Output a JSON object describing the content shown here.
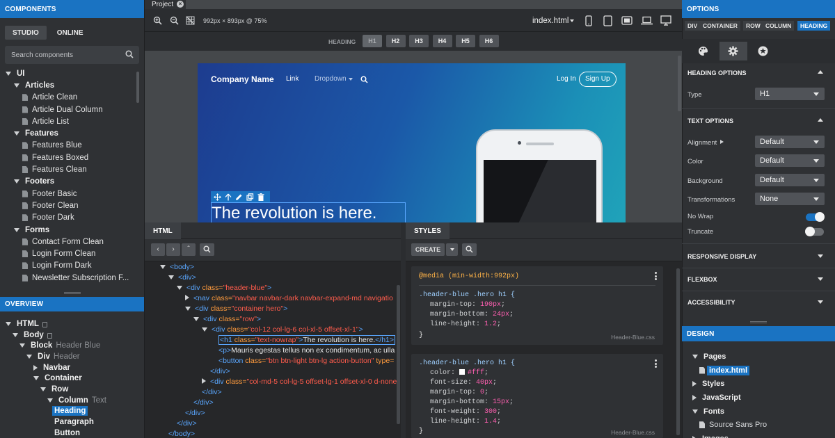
{
  "components": {
    "header": "COMPONENTS",
    "tabs": [
      "STUDIO",
      "ONLINE"
    ],
    "search_placeholder": "Search components",
    "tree": [
      {
        "label": "UI",
        "level": 0,
        "kind": "group"
      },
      {
        "label": "Articles",
        "level": 1,
        "kind": "group"
      },
      {
        "label": "Article Clean",
        "level": 2,
        "kind": "item"
      },
      {
        "label": "Article Dual Column",
        "level": 2,
        "kind": "item"
      },
      {
        "label": "Article List",
        "level": 2,
        "kind": "item"
      },
      {
        "label": "Features",
        "level": 1,
        "kind": "group"
      },
      {
        "label": "Features Blue",
        "level": 2,
        "kind": "item"
      },
      {
        "label": "Features Boxed",
        "level": 2,
        "kind": "item"
      },
      {
        "label": "Features Clean",
        "level": 2,
        "kind": "item"
      },
      {
        "label": "Footers",
        "level": 1,
        "kind": "group"
      },
      {
        "label": "Footer Basic",
        "level": 2,
        "kind": "item"
      },
      {
        "label": "Footer Clean",
        "level": 2,
        "kind": "item"
      },
      {
        "label": "Footer Dark",
        "level": 2,
        "kind": "item"
      },
      {
        "label": "Forms",
        "level": 1,
        "kind": "group"
      },
      {
        "label": "Contact Form Clean",
        "level": 2,
        "kind": "item"
      },
      {
        "label": "Login Form Clean",
        "level": 2,
        "kind": "item"
      },
      {
        "label": "Login Form Dark",
        "level": 2,
        "kind": "item"
      },
      {
        "label": "Newsletter Subscription F...",
        "level": 2,
        "kind": "item"
      }
    ]
  },
  "overview": {
    "header": "OVERVIEW",
    "tree": [
      {
        "label": "HTML",
        "sub": "",
        "level": 0,
        "lock": true,
        "selected": false
      },
      {
        "label": "Body",
        "sub": "",
        "level": 1,
        "lock": true,
        "selected": false
      },
      {
        "label": "Block",
        "sub": "Header Blue",
        "level": 2,
        "lock": false,
        "selected": false
      },
      {
        "label": "Div",
        "sub": "Header",
        "level": 3,
        "lock": false,
        "selected": false
      },
      {
        "label": "Navbar",
        "sub": "",
        "level": 4,
        "lock": false,
        "selected": false,
        "collapsed": true
      },
      {
        "label": "Container",
        "sub": "",
        "level": 4,
        "lock": false,
        "selected": false
      },
      {
        "label": "Row",
        "sub": "",
        "level": 5,
        "lock": false,
        "selected": false
      },
      {
        "label": "Column",
        "sub": "Text",
        "level": 6,
        "lock": false,
        "selected": false
      },
      {
        "label": "Heading",
        "sub": "",
        "level": 7,
        "lock": false,
        "selected": true
      },
      {
        "label": "Paragraph",
        "sub": "",
        "level": 7,
        "lock": false,
        "selected": false
      },
      {
        "label": "Button",
        "sub": "",
        "level": 7,
        "lock": false,
        "selected": false
      }
    ]
  },
  "project": {
    "tab": "Project",
    "dimensions": "992px × 893px @ 75%",
    "file": "index.html",
    "heading_label": "HEADING",
    "heading_buttons": [
      "H1",
      "H2",
      "H3",
      "H4",
      "H5",
      "H6"
    ],
    "active_heading": "H1"
  },
  "preview": {
    "brand": "Company Name",
    "nav": [
      "Link",
      "Dropdown"
    ],
    "login": "Log In",
    "signup": "Sign Up",
    "headline": "The revolution is here."
  },
  "html_panel": {
    "tab": "HTML",
    "lines": [
      {
        "indent": 0,
        "open": true,
        "parts": [
          [
            "tg",
            "<body>"
          ]
        ]
      },
      {
        "indent": 1,
        "open": true,
        "parts": [
          [
            "tg",
            "<div>"
          ]
        ]
      },
      {
        "indent": 2,
        "open": true,
        "parts": [
          [
            "tg",
            "<div "
          ],
          [
            "at",
            "class="
          ],
          [
            "sv",
            "\"header-blue\""
          ],
          [
            "tg",
            ">"
          ]
        ]
      },
      {
        "indent": 3,
        "open": false,
        "parts": [
          [
            "tg",
            "<nav "
          ],
          [
            "at",
            "class="
          ],
          [
            "sv",
            "\"navbar navbar-dark navbar-expand-md navigatio"
          ]
        ]
      },
      {
        "indent": 3,
        "open": true,
        "parts": [
          [
            "tg",
            "<div "
          ],
          [
            "at",
            "class="
          ],
          [
            "sv",
            "\"container hero\""
          ],
          [
            "tg",
            ">"
          ]
        ]
      },
      {
        "indent": 4,
        "open": true,
        "parts": [
          [
            "tg",
            "<div "
          ],
          [
            "at",
            "class="
          ],
          [
            "sv",
            "\"row\""
          ],
          [
            "tg",
            ">"
          ]
        ]
      },
      {
        "indent": 5,
        "open": true,
        "parts": [
          [
            "tg",
            "<div "
          ],
          [
            "at",
            "class="
          ],
          [
            "sv",
            "\"col-12 col-lg-6 col-xl-5 offset-xl-1\""
          ],
          [
            "tg",
            ">"
          ]
        ]
      },
      {
        "indent": 6,
        "open": null,
        "selected": true,
        "parts": [
          [
            "tg",
            "<h1 "
          ],
          [
            "at",
            "class="
          ],
          [
            "sv",
            "\"text-nowrap\""
          ],
          [
            "tg",
            ">"
          ],
          [
            "tx",
            "The revolution is here."
          ],
          [
            "tg",
            "</h1>"
          ]
        ]
      },
      {
        "indent": 6,
        "open": null,
        "parts": [
          [
            "tg",
            "<p>"
          ],
          [
            "tx",
            "Mauris egestas tellus non ex condimentum, ac ulla"
          ]
        ]
      },
      {
        "indent": 6,
        "open": null,
        "parts": [
          [
            "tg",
            "<button "
          ],
          [
            "at",
            "class="
          ],
          [
            "sv",
            "\"btn btn-light btn-lg action-button\""
          ],
          [
            "at",
            " type="
          ]
        ]
      },
      {
        "indent": 5,
        "open": null,
        "parts": [
          [
            "tg",
            "</div>"
          ]
        ]
      },
      {
        "indent": 5,
        "open": false,
        "parts": [
          [
            "tg",
            "<div "
          ],
          [
            "at",
            "class="
          ],
          [
            "sv",
            "\"col-md-5 col-lg-5 offset-lg-1 offset-xl-0 d-none"
          ]
        ]
      },
      {
        "indent": 4,
        "open": null,
        "parts": [
          [
            "tg",
            "</div>"
          ]
        ]
      },
      {
        "indent": 3,
        "open": null,
        "parts": [
          [
            "tg",
            "</div>"
          ]
        ]
      },
      {
        "indent": 2,
        "open": null,
        "parts": [
          [
            "tg",
            "</div>"
          ]
        ]
      },
      {
        "indent": 1,
        "open": null,
        "parts": [
          [
            "tg",
            "</div>"
          ]
        ]
      },
      {
        "indent": 0,
        "open": null,
        "parts": [
          [
            "tg",
            "</body>"
          ]
        ]
      }
    ]
  },
  "styles_panel": {
    "tab": "STYLES",
    "create": "CREATE",
    "rule1": {
      "media": "@media (min-width:992px)",
      "selector": ".header-blue .hero h1 {",
      "props": [
        [
          "margin-top",
          "190px"
        ],
        [
          "margin-bottom",
          "24px"
        ],
        [
          "line-height",
          "1.2"
        ]
      ],
      "file": "Header-Blue.css"
    },
    "rule2": {
      "selector": ".header-blue .hero h1 {",
      "props": [
        [
          "color",
          "#fff"
        ],
        [
          "font-size",
          "40px"
        ],
        [
          "margin-top",
          "0"
        ],
        [
          "margin-bottom",
          "15px"
        ],
        [
          "font-weight",
          "300"
        ],
        [
          "line-height",
          "1.4"
        ]
      ],
      "file": "Header-Blue.css"
    }
  },
  "options": {
    "header": "OPTIONS",
    "tabs": [
      "DIV",
      "CONTAINER",
      "ROW",
      "COLUMN",
      "HEADING"
    ],
    "heading_options": "HEADING OPTIONS",
    "type_label": "Type",
    "type_value": "H1",
    "text_options": "TEXT OPTIONS",
    "alignment_label": "Alignment",
    "alignment_value": "Default",
    "color_label": "Color",
    "color_value": "Default",
    "background_label": "Background",
    "background_value": "Default",
    "transformations_label": "Transformations",
    "transformations_value": "None",
    "nowrap_label": "No Wrap",
    "nowrap_on": true,
    "truncate_label": "Truncate",
    "truncate_on": false,
    "responsive": "RESPONSIVE DISPLAY",
    "flexbox": "FLEXBOX",
    "accessibility": "ACCESSIBILITY"
  },
  "design": {
    "header": "DESIGN",
    "items": [
      {
        "label": "Pages",
        "level": 0,
        "open": true
      },
      {
        "label": "index.html",
        "level": 1,
        "open": null,
        "selected": true
      },
      {
        "label": "Styles",
        "level": 0,
        "open": false
      },
      {
        "label": "JavaScript",
        "level": 0,
        "open": false
      },
      {
        "label": "Fonts",
        "level": 0,
        "open": true
      },
      {
        "label": "Source Sans Pro",
        "level": 1,
        "open": null
      },
      {
        "label": "Images",
        "level": 0,
        "open": false
      }
    ]
  },
  "colors": {
    "accent": "#1a73c2",
    "panel": "#2f3134",
    "code_bg": "#262729"
  }
}
